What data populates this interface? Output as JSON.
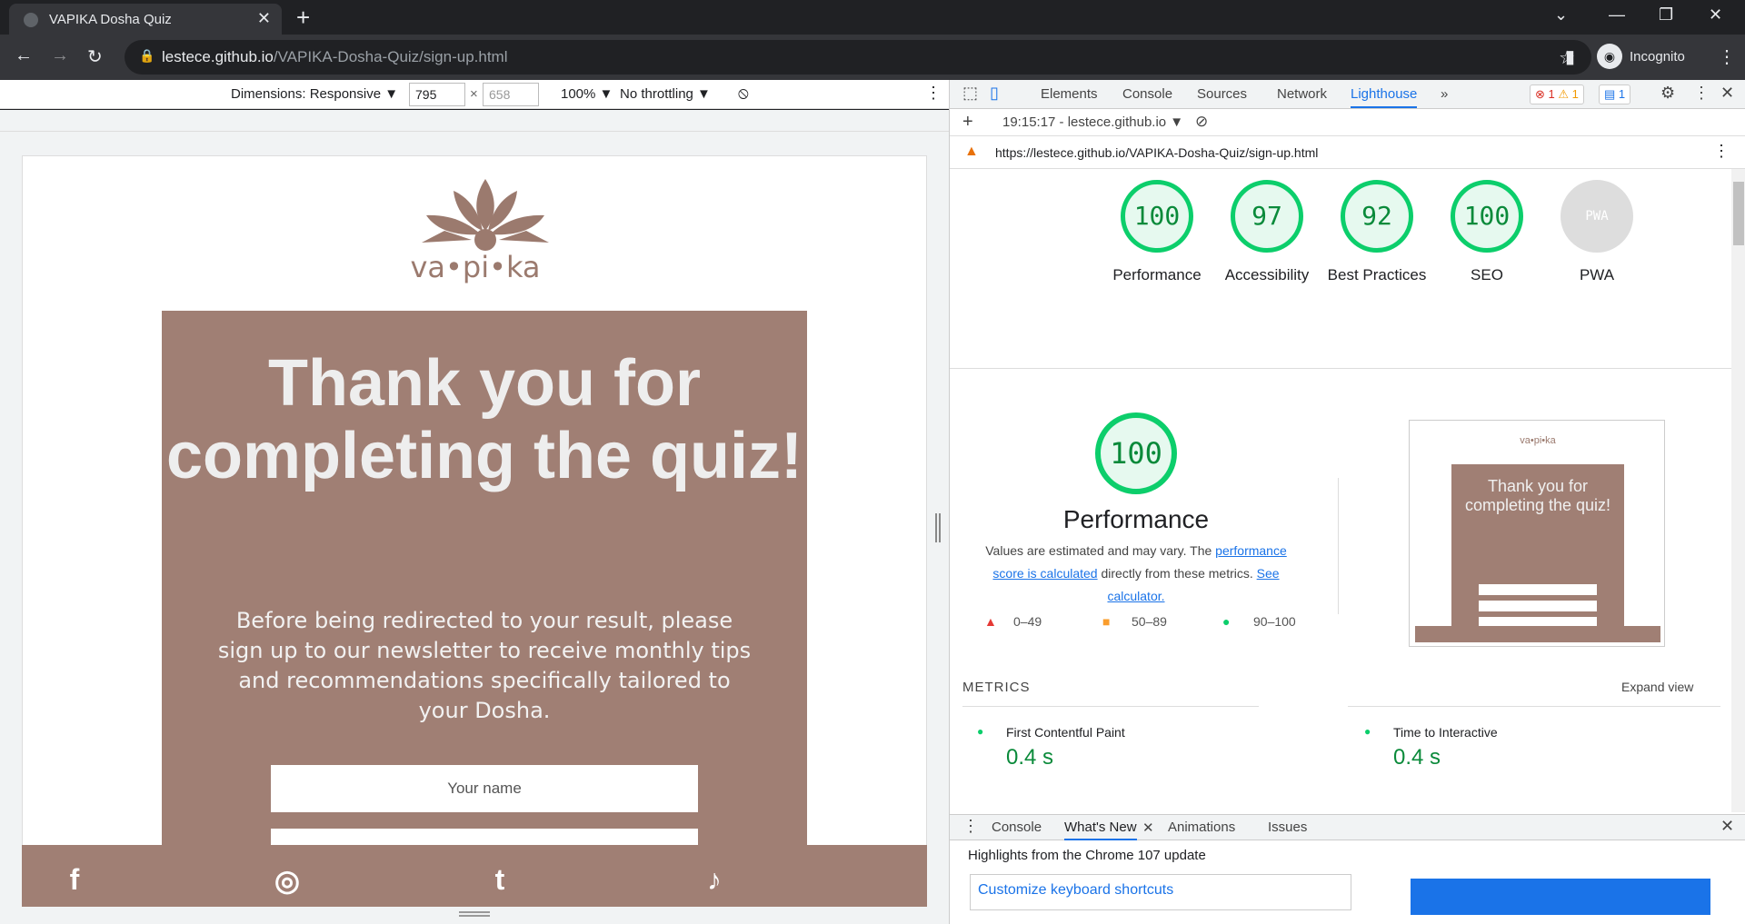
{
  "browser": {
    "tab_title": "VAPIKA Dosha Quiz",
    "url_host": "lestece.github.io",
    "url_path": "/VAPIKA-Dosha-Quiz/sign-up.html",
    "profile": "Incognito"
  },
  "device_toolbar": {
    "dimensions_label": "Dimensions: Responsive ▼",
    "width": "795",
    "height": "658",
    "zoom": "100% ▼",
    "throttling": "No throttling ▼"
  },
  "page": {
    "logo_text": "va•pi•ka",
    "heading": "Thank you for completing the quiz!",
    "description": "Before being redirected to your result, please sign up to our newsletter to receive monthly tips and recommendations specifically tailored to your Dosha.",
    "name_placeholder": "Your name",
    "social": [
      "f",
      "◎",
      "t",
      "♪"
    ]
  },
  "devtools": {
    "tabs": [
      "Elements",
      "Console",
      "Sources",
      "Network",
      "Lighthouse",
      "»"
    ],
    "active_tab": "Lighthouse",
    "badges": {
      "errors": "1",
      "warnings": "1",
      "messages": "1"
    },
    "report_time": "19:15:17 - lestece.github.io ▼",
    "report_url": "https://lestece.github.io/VAPIKA-Dosha-Quiz/sign-up.html",
    "scores": [
      {
        "label": "Performance",
        "value": "100"
      },
      {
        "label": "Accessibility",
        "value": "97"
      },
      {
        "label": "Best Practices",
        "value": "92"
      },
      {
        "label": "SEO",
        "value": "100"
      },
      {
        "label": "PWA",
        "value": "PWA"
      }
    ],
    "perf_score": "100",
    "perf_title": "Performance",
    "perf_desc_1": "Values are estimated and may vary. The ",
    "perf_link_1": "performance score is calculated",
    "perf_desc_2": " directly from these metrics. ",
    "perf_link_2": "See calculator.",
    "legend": [
      "0–49",
      "50–89",
      "90–100"
    ],
    "metrics_label": "METRICS",
    "expand_view": "Expand view",
    "metric_1": {
      "name": "First Contentful Paint",
      "value": "0.4 s"
    },
    "metric_2": {
      "name": "Time to Interactive",
      "value": "0.4 s"
    },
    "thumb_title": "Thank you for completing the quiz!",
    "thumb_logo": "va•pi•ka"
  },
  "drawer": {
    "tabs": [
      "Console",
      "What's New",
      "Animations",
      "Issues"
    ],
    "highlights": "Highlights from the Chrome 107 update",
    "customize": "Customize keyboard shortcuts"
  }
}
